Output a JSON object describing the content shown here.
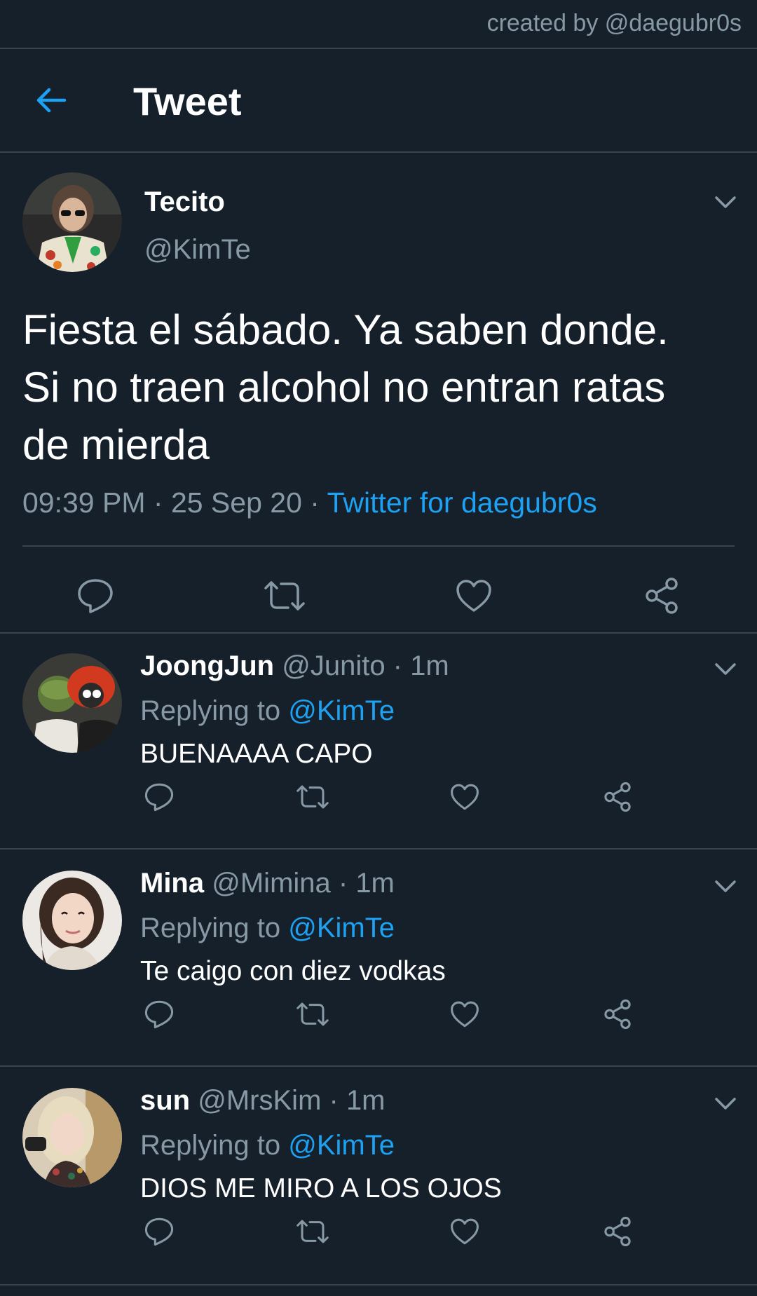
{
  "credit": "created by @daegubr0s",
  "header": {
    "title": "Tweet"
  },
  "main_tweet": {
    "name": "Tecito",
    "handle": "@KimTe",
    "text_lines": [
      "Fiesta el sábado. Ya saben donde.",
      "Si no traen alcohol no entran ratas",
      "de mierda"
    ],
    "time": "09:39 PM",
    "date": "25 Sep 20",
    "source": "Twitter for daegubr0s",
    "separator": " · "
  },
  "replies": [
    {
      "name": "JoongJun",
      "handle": "@Junito",
      "time": "1m",
      "replying_label": "Replying to",
      "replying_to": "@KimTe",
      "text": "BUENAAAA CAPO"
    },
    {
      "name": "Mina",
      "handle": "@Mimina",
      "time": "1m",
      "replying_label": "Replying to",
      "replying_to": "@KimTe",
      "text": "Te caigo con diez vodkas"
    },
    {
      "name": "sun",
      "handle": "@MrsKim",
      "time": "1m",
      "replying_label": "Replying to",
      "replying_to": "@KimTe",
      "text": "DIOS ME MIRO A LOS OJOS"
    }
  ],
  "colors": {
    "background": "#15202b",
    "accent": "#1da1f2",
    "muted": "#8899a6",
    "divider": "#38444d"
  },
  "icons": [
    "back-arrow-icon",
    "chevron-down-icon",
    "reply-icon",
    "retweet-icon",
    "like-icon",
    "share-icon"
  ]
}
